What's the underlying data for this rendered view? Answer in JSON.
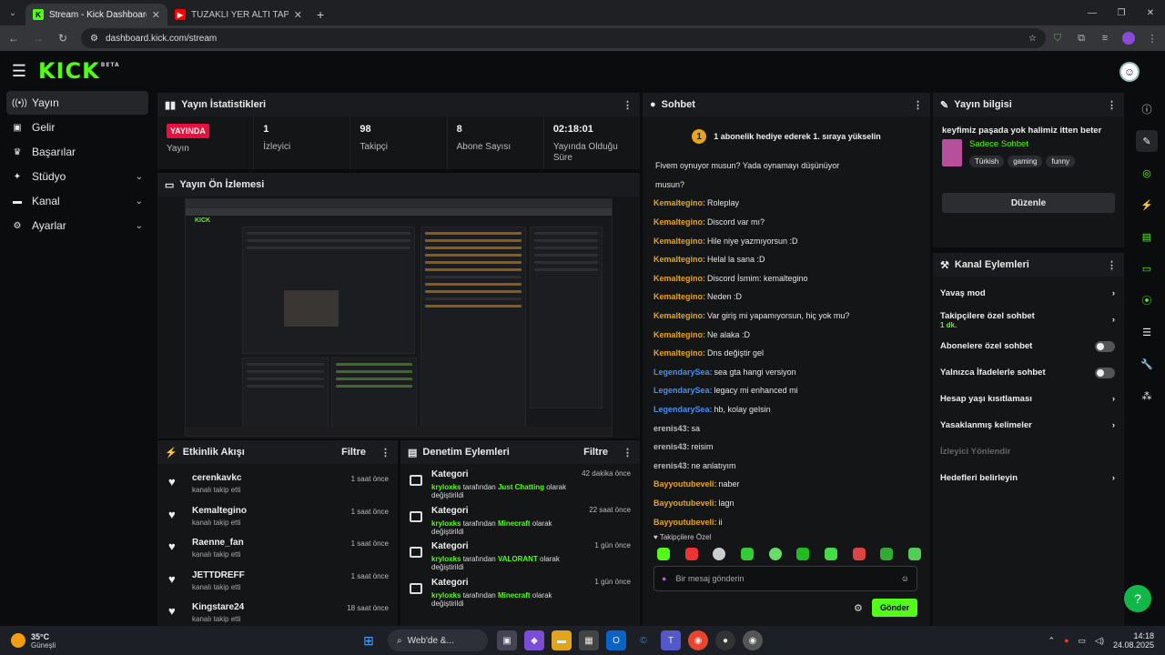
{
  "browser": {
    "tabs": [
      {
        "title": "Stream - Kick Dashboard",
        "active": true
      },
      {
        "title": "TUZAKLI YER ALTI TAPINAĞINA...",
        "active": false
      }
    ],
    "url": "dashboard.kick.com/stream"
  },
  "header": {
    "logo": "KICK",
    "badge": "BETA"
  },
  "sidebar": {
    "items": [
      {
        "label": "Yayın",
        "icon": "broadcast-icon",
        "active": true
      },
      {
        "label": "Gelir",
        "icon": "money-icon"
      },
      {
        "label": "Başarılar",
        "icon": "trophy-icon"
      },
      {
        "label": "Stüdyo",
        "icon": "studio-icon",
        "chevron": true
      },
      {
        "label": "Kanal",
        "icon": "channel-icon",
        "chevron": true
      },
      {
        "label": "Ayarlar",
        "icon": "gear-icon",
        "chevron": true
      }
    ]
  },
  "stats": {
    "title": "Yayın İstatistikleri",
    "live_badge": "YAYINDA",
    "items": [
      {
        "value": "",
        "label": "Yayın"
      },
      {
        "value": "1",
        "label": "İzleyici"
      },
      {
        "value": "98",
        "label": "Takipçi"
      },
      {
        "value": "8",
        "label": "Abone Sayısı"
      },
      {
        "value": "02:18:01",
        "label": "Yayında Olduğu Süre"
      }
    ]
  },
  "preview": {
    "title": "Yayın Ön İzlemesi"
  },
  "feed": {
    "title": "Etkinlik Akışı",
    "filter": "Filtre",
    "items": [
      {
        "name": "cerenkavkc",
        "sub": "kanalı takip etti",
        "time": "1 saat önce"
      },
      {
        "name": "Kemaltegino",
        "sub": "kanalı takip etti",
        "time": "1 saat önce"
      },
      {
        "name": "Raenne_fan",
        "sub": "kanalı takip etti",
        "time": "1 saat önce"
      },
      {
        "name": "JETTDREFF",
        "sub": "kanalı takip etti",
        "time": "1 saat önce"
      },
      {
        "name": "Kingstare24",
        "sub": "kanalı takip etti",
        "time": "18 saat önce"
      }
    ]
  },
  "mod": {
    "title": "Denetim Eylemleri",
    "filter": "Filtre",
    "items": [
      {
        "title": "Kategori",
        "user": "kryloxks",
        "mid": " tarafından ",
        "cat": "Just Chatting",
        "end": " olarak değiştirildi",
        "time": "42 dakika önce"
      },
      {
        "title": "Kategori",
        "user": "kryloxks",
        "mid": " tarafından ",
        "cat": "Minecraft",
        "end": " olarak değiştirildi",
        "time": "22 saat önce"
      },
      {
        "title": "Kategori",
        "user": "kryloxks",
        "mid": " tarafından ",
        "cat": "VALORANT",
        "end": " olarak değiştirildi",
        "time": "1 gün önce"
      },
      {
        "title": "Kategori",
        "user": "kryloxks",
        "mid": " tarafından ",
        "cat": "Minecraft",
        "end": " olarak değiştirildi",
        "time": "1 gün önce"
      }
    ]
  },
  "chat": {
    "title": "Sohbet",
    "banner": "1 abonelik hediye ederek 1. sıraya yükselin",
    "banner_num": "1",
    "messages": [
      {
        "n": "",
        "t": "Fivem oynuyor musun? Yada oynamayı düşünüyor",
        "c": "#e9a41b"
      },
      {
        "n": "",
        "t": "musun?",
        "c": "#e9a41b"
      },
      {
        "n": "Kemaltegino",
        "t": "Roleplay",
        "c": "#e9a41b"
      },
      {
        "n": "Kemaltegino",
        "t": "Discord var mı?",
        "c": "#e9a41b"
      },
      {
        "n": "Kemaltegino",
        "t": "Hile niye yazmıyorsun :D",
        "c": "#e9a41b"
      },
      {
        "n": "Kemaltegino",
        "t": "Helal la sana :D",
        "c": "#e9a41b"
      },
      {
        "n": "Kemaltegino",
        "t": "Discord İsmim: kemaltegino",
        "c": "#e9a41b"
      },
      {
        "n": "Kemaltegino",
        "t": "Neden :D",
        "c": "#e9a41b"
      },
      {
        "n": "Kemaltegino",
        "t": "Var giriş mi yapamıyorsun, hiç yok mu?",
        "c": "#e9a41b"
      },
      {
        "n": "Kemaltegino",
        "t": "Ne alaka :D",
        "c": "#e9a41b"
      },
      {
        "n": "Kemaltegino",
        "t": "Dns değiştir gel",
        "c": "#e9a41b"
      },
      {
        "n": "LegendarySea",
        "t": "sea gta hangi versiyon",
        "c": "#4a8ff0"
      },
      {
        "n": "LegendarySea",
        "t": "legacy mi enhanced mi",
        "c": "#4a8ff0"
      },
      {
        "n": "LegendarySea",
        "t": "hb, kolay gelsin",
        "c": "#4a8ff0"
      },
      {
        "n": "erenis43",
        "t": "sa",
        "c": "#bbbbbb"
      },
      {
        "n": "erenis43",
        "t": "reisim",
        "c": "#bbbbbb"
      },
      {
        "n": "erenis43",
        "t": "ne anlatıyım",
        "c": "#bbbbbb"
      },
      {
        "n": "Bayyoutubeveli",
        "t": "naber",
        "c": "#e9a41b"
      },
      {
        "n": "Bayyoutubeveli",
        "t": "lagn",
        "c": "#e9a41b"
      },
      {
        "n": "Bayyoutubeveli",
        "t": "ii",
        "c": "#e9a41b"
      }
    ],
    "followers_only": "Takipçilere Özel",
    "placeholder": "Bir mesaj gönderin",
    "send": "Gönder"
  },
  "info": {
    "title": "Yayın bilgisi",
    "stream_title": "keyfimiz paşada yok halimiz itten beter",
    "category": "Sadece Sohbet",
    "tags": [
      "Türkish",
      "gaming",
      "funny"
    ],
    "edit": "Düzenle"
  },
  "channel": {
    "title": "Kanal Eylemleri",
    "items": [
      {
        "label": "Yavaş mod",
        "type": "chev"
      },
      {
        "label": "Takipçilere özel sohbet",
        "sub": "1 dk.",
        "type": "chev"
      },
      {
        "label": "Abonelere özel sohbet",
        "type": "toggle"
      },
      {
        "label": "Yalnızca İfadelerle sohbet",
        "type": "toggle"
      },
      {
        "label": "Hesap yaşı kısıtlaması",
        "type": "chev"
      },
      {
        "label": "Yasaklanmış kelimeler",
        "type": "chev"
      },
      {
        "label": "İzleyici Yönlendir",
        "type": "disabled"
      },
      {
        "label": "Hedefleri belirleyin",
        "type": "chev"
      }
    ]
  },
  "taskbar": {
    "weather_temp": "35°C",
    "weather_desc": "Güneşli",
    "search": "Web'de &...",
    "time": "14:18",
    "date": "24.08.2025"
  }
}
